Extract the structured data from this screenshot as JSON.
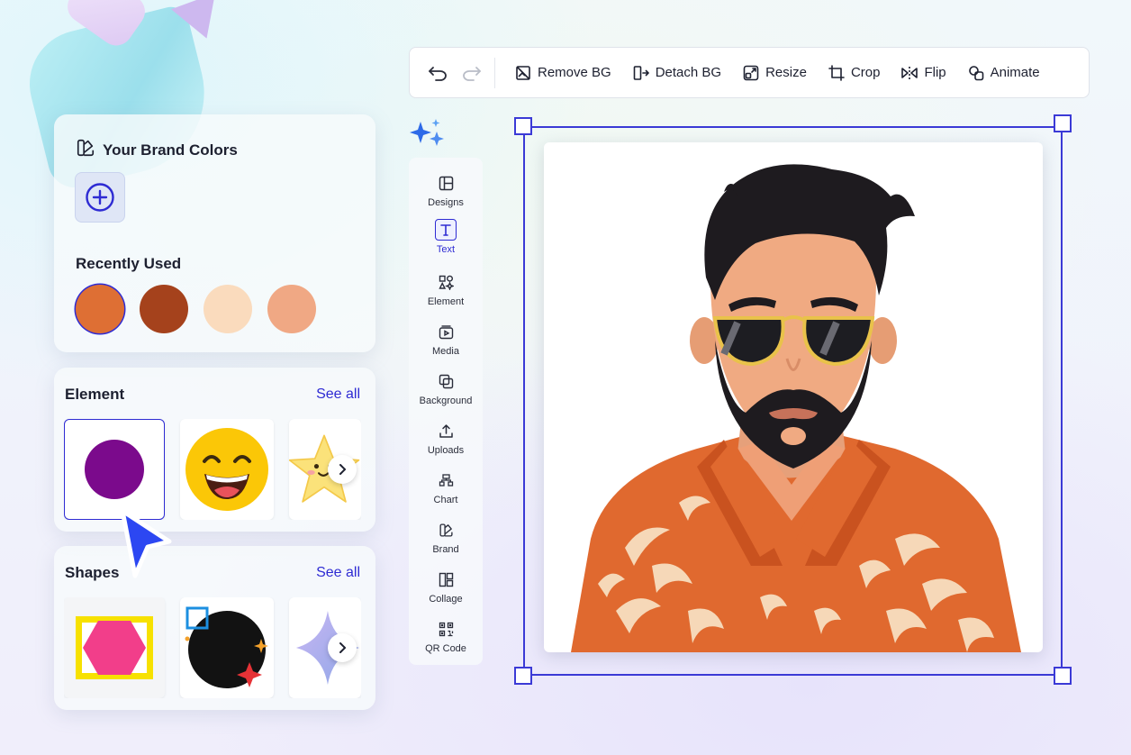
{
  "brand_colors": {
    "title": "Your Brand Colors",
    "recently_used_title": "Recently Used",
    "recent_colors": [
      "#de6f34",
      "#a5421c",
      "#fadbbd",
      "#f0a884"
    ]
  },
  "element_section": {
    "title": "Element",
    "see_all": "See all"
  },
  "shapes_section": {
    "title": "Shapes",
    "see_all": "See all"
  },
  "toolbar": {
    "remove_bg": "Remove BG",
    "detach_bg": "Detach BG",
    "resize": "Resize",
    "crop": "Crop",
    "flip": "Flip",
    "animate": "Animate"
  },
  "rail": {
    "items": [
      {
        "label": "Designs",
        "icon": "layout-icon"
      },
      {
        "label": "Text",
        "icon": "text-icon"
      },
      {
        "label": "Element",
        "icon": "shapes-icon"
      },
      {
        "label": "Media",
        "icon": "media-icon"
      },
      {
        "label": "Background",
        "icon": "background-icon"
      },
      {
        "label": "Uploads",
        "icon": "upload-icon"
      },
      {
        "label": "Chart",
        "icon": "chart-icon"
      },
      {
        "label": "Brand",
        "icon": "brand-icon"
      },
      {
        "label": "Collage",
        "icon": "collage-icon"
      },
      {
        "label": "QR Code",
        "icon": "qr-code-icon"
      }
    ],
    "active": "Text"
  },
  "colors": {
    "accent": "#2e2bd3",
    "selection": "#3b3ad6"
  }
}
